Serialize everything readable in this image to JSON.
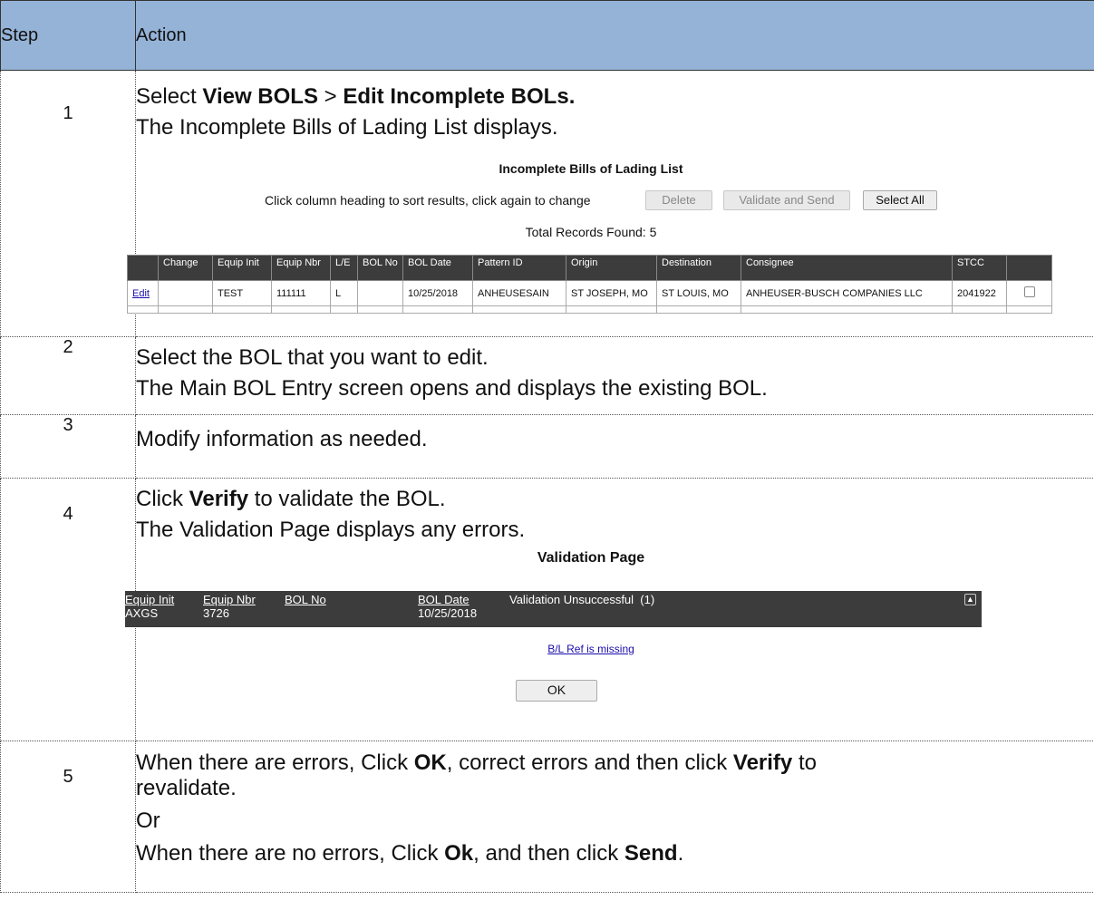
{
  "header": {
    "step": "Step",
    "action": "Action"
  },
  "steps": [
    {
      "num": "1",
      "line1_pre": "Select ",
      "line1_b1": "View BOLS",
      "line1_mid": " > ",
      "line1_b2": "Edit Incomplete BOLs.",
      "line2": "The Incomplete Bills of Lading List displays."
    },
    {
      "num": "2",
      "line1": "Select the BOL that you want to edit.",
      "line2": "The Main BOL Entry screen opens and displays the existing BOL."
    },
    {
      "num": "3",
      "line1": "Modify information as needed."
    },
    {
      "num": "4",
      "line1_pre": "Click ",
      "line1_b": "Verify",
      "line1_post": " to validate the BOL.",
      "line2": "The Validation Page displays any errors."
    },
    {
      "num": "5",
      "l1_a": "When there are errors, Click ",
      "l1_b": "OK",
      "l1_c": ", correct errors and then click ",
      "l1_d": "Verify",
      "l1_e": " to",
      "l2": "revalidate.",
      "l3": "Or",
      "l4_a": "When there are no errors, Click ",
      "l4_b": "Ok",
      "l4_c": ", and then click ",
      "l4_d": "Send",
      "l4_e": "."
    }
  ],
  "incomplete_list": {
    "title": "Incomplete Bills of Lading List",
    "hint": "Click column heading to sort results, click again to change",
    "delete_label": "Delete",
    "validate_send_label": "Validate and Send",
    "select_all_label": "Select All",
    "total": "Total Records Found: 5",
    "columns": [
      "",
      "Change",
      "Equip Init",
      "Equip Nbr",
      "L/E",
      "BOL No",
      "BOL Date",
      "Pattern ID",
      "Origin",
      "Destination",
      "Consignee",
      "STCC",
      ""
    ],
    "row": {
      "edit": "Edit",
      "change": "",
      "equip_init": "TEST",
      "equip_nbr": "111111",
      "le": "L",
      "bol_no": "",
      "bol_date": "10/25/2018",
      "pattern_id": "ANHEUSESAIN",
      "origin": "ST JOSEPH, MO",
      "destination": "ST LOUIS, MO",
      "consignee": "ANHEUSER-BUSCH COMPANIES LLC",
      "stcc": "2041922"
    }
  },
  "validation": {
    "title": "Validation Page",
    "h_equip_init": "Equip Init",
    "h_equip_nbr": "Equip Nbr",
    "h_bol_no": "BOL No",
    "h_bol_date": "BOL Date",
    "status": "Validation Unsuccessful  (1)",
    "equip_init": "AXGS",
    "equip_nbr": "3726",
    "bol_date": "10/25/2018",
    "error": "B/L Ref is missing",
    "ok_label": "OK"
  }
}
